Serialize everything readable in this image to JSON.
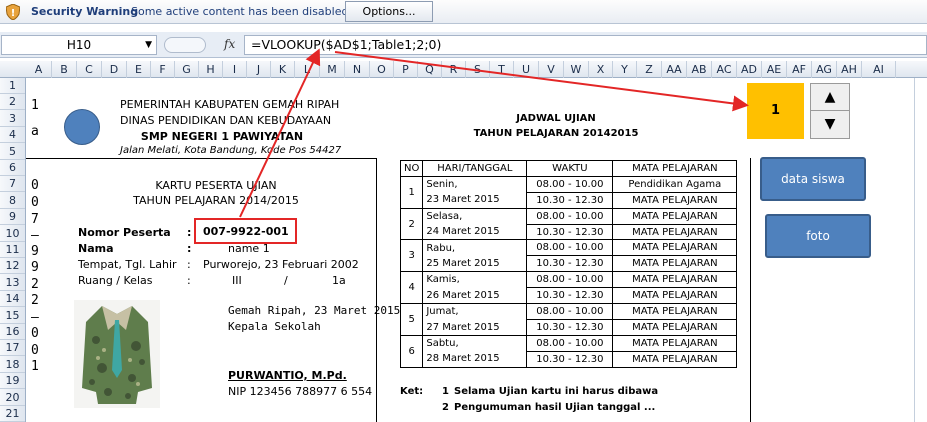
{
  "security_bar": {
    "title": "Security Warning",
    "message": "Some active content has been disabled.",
    "options_label": "Options..."
  },
  "formula_bar": {
    "name_box": "H10",
    "fx_label": "fx",
    "formula": "=VLOOKUP($AD$1;Table1;2;0)"
  },
  "columns": [
    "A",
    "B",
    "C",
    "D",
    "E",
    "F",
    "G",
    "H",
    "I",
    "J",
    "K",
    "L",
    "M",
    "N",
    "O",
    "P",
    "Q",
    "R",
    "S",
    "T",
    "U",
    "V",
    "W",
    "X",
    "Y",
    "Z",
    "AA",
    "AB",
    "AC",
    "AD",
    "AE",
    "AF",
    "AG",
    "AH",
    "AI"
  ],
  "rows": [
    "1",
    "2",
    "3",
    "4",
    "5",
    "6",
    "7",
    "8",
    "9",
    "10",
    "11",
    "12",
    "13",
    "14",
    "15",
    "16",
    "17",
    "18",
    "19",
    "20",
    "21"
  ],
  "vertical_chars": [
    "1",
    "a",
    "",
    "",
    "0",
    "0",
    "7",
    "–",
    "9",
    "9",
    "2",
    "2",
    "–",
    "0",
    "0",
    "1"
  ],
  "header": {
    "line1": "PEMERINTAH KABUPATEN GEMAH RIPAH",
    "line2": "DINAS PENDIDIKAN DAN KEBUDAYAAN",
    "line3": "SMP NEGERI 1 PAWIYATAN",
    "address": "Jalan Melati, Kota Bandung, Kode Pos 54427"
  },
  "card": {
    "title": "KARTU PESERTA UJIAN",
    "subtitle": "TAHUN PELAJARAN 2014/2015",
    "fields": [
      {
        "label": "Nomor Peserta",
        "sep": ":",
        "value": "007-9922-001"
      },
      {
        "label": "Nama",
        "sep": ":",
        "value": "name 1"
      },
      {
        "label": "Tempat, Tgl. Lahir",
        "sep": ":",
        "value": "Purworejo, 23 Februari 2002"
      },
      {
        "label": "Ruang / Kelas",
        "sep": ":",
        "value_a": "III",
        "value_slash": "/",
        "value_b": "1a"
      }
    ],
    "place_date": "Gemah Ripah, 23 Maret 2015",
    "signer_title": "Kepala Sekolah",
    "signer_name": "PURWANTIO, M.Pd.",
    "signer_nip": "NIP 123456 788977 6 554"
  },
  "schedule": {
    "title": "JADWAL UJIAN",
    "subtitle": "TAHUN PELAJARAN 20142015",
    "headers": [
      "NO",
      "HARI/TANGGAL",
      "WAKTU",
      "MATA PELAJARAN"
    ],
    "rows": [
      {
        "no": "1",
        "day": "Senin,",
        "date": "23 Maret 2015",
        "t1": "08.00 - 10.00",
        "t2": "10.30 - 12.30",
        "s1": "Pendidikan Agama",
        "s2": "MATA PELAJARAN"
      },
      {
        "no": "2",
        "day": "Selasa,",
        "date": "24 Maret 2015",
        "t1": "08.00 - 10.00",
        "t2": "10.30 - 12.30",
        "s1": "MATA PELAJARAN",
        "s2": "MATA PELAJARAN"
      },
      {
        "no": "3",
        "day": "Rabu,",
        "date": "25 Maret 2015",
        "t1": "08.00 - 10.00",
        "t2": "10.30 - 12.30",
        "s1": "MATA PELAJARAN",
        "s2": "MATA PELAJARAN"
      },
      {
        "no": "4",
        "day": "Kamis,",
        "date": "26 Maret 2015",
        "t1": "08.00 - 10.00",
        "t2": "10.30 - 12.30",
        "s1": "MATA PELAJARAN",
        "s2": "MATA PELAJARAN"
      },
      {
        "no": "5",
        "day": "Jumat,",
        "date": "27 Maret 2015",
        "t1": "08.00 - 10.00",
        "t2": "10.30 - 12.30",
        "s1": "MATA PELAJARAN",
        "s2": "MATA PELAJARAN"
      },
      {
        "no": "6",
        "day": "Sabtu,",
        "date": "28 Maret 2015",
        "t1": "08.00 - 10.00",
        "t2": "10.30 - 12.30",
        "s1": "MATA PELAJARAN",
        "s2": "MATA PELAJARAN"
      }
    ],
    "notes_label": "Ket:",
    "notes": [
      {
        "no": "1",
        "text": "Selama Ujian kartu ini harus dibawa"
      },
      {
        "no": "2",
        "text": "Pengumuman hasil Ujian tanggal ..."
      }
    ]
  },
  "controls": {
    "selector_value": "1",
    "spin_up": "▲",
    "spin_down": "▼",
    "data_button": "data siswa",
    "photo_button": "foto"
  },
  "colors": {
    "selector_bg": "#ffc000",
    "button_bg": "#4f81bd",
    "highlight": "#e32626"
  }
}
